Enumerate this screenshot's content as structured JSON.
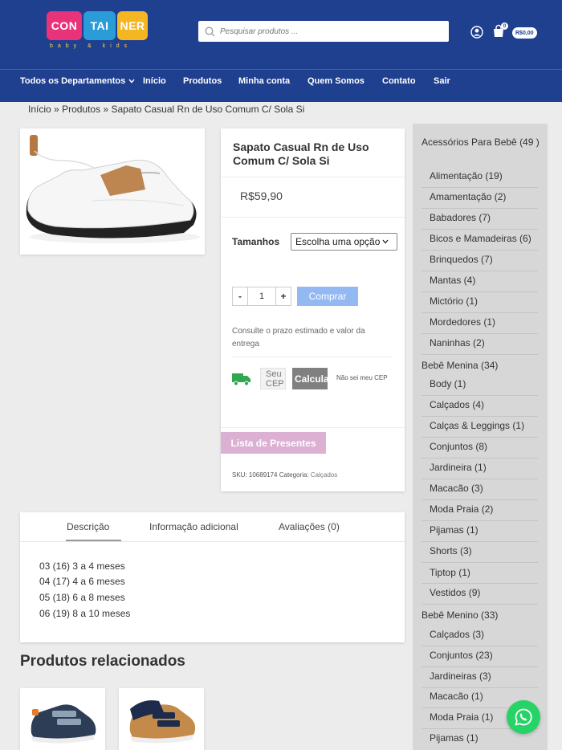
{
  "header": {
    "logo": {
      "parts": [
        "CON",
        "TAI",
        "NER"
      ],
      "tagline": "baby & kids"
    },
    "search_placeholder": "Pesquisar produtos ...",
    "cart_count": "0",
    "cart_total": "R$0,00",
    "icons": {
      "user": "user-icon",
      "cart": "cart-icon",
      "search": "search-icon"
    }
  },
  "nav": [
    {
      "label": "Todos os Departamentos"
    },
    {
      "label": "Início"
    },
    {
      "label": "Produtos"
    },
    {
      "label": "Minha conta"
    },
    {
      "label": "Quem Somos"
    },
    {
      "label": "Contato"
    },
    {
      "label": "Sair"
    }
  ],
  "breadcrumb": {
    "home": "Início",
    "sep": "»",
    "products": "Produtos",
    "current": "Sapato Casual Rn de Uso Comum C/ Sola Si"
  },
  "product": {
    "title": "Sapato Casual Rn de Uso Comum C/ Sola Si",
    "price": "R$59,90",
    "size_label": "Tamanhos",
    "size_select": "Escolha uma opção",
    "qty_minus": "-",
    "qty_value": "1",
    "qty_plus": "+",
    "buy_label": "Comprar",
    "shipping_note": "Consulte o prazo estimado e valor da entrega",
    "cep_placeholder": "Seu CEP",
    "cep_button": "Calcular",
    "cep_link": "Não sei meu CEP",
    "gift_button": "Lista de Presentes",
    "sku_label": "SKU:",
    "sku_value": "10689174",
    "category_label": "Categoria:",
    "category_value": "Calçados"
  },
  "tabs": {
    "items": [
      "Descrição",
      "Informação adicional",
      "Avaliações (0)"
    ],
    "description_lines": [
      "03 (16) 3 a 4 meses",
      "04 (17) 4 a 6 meses",
      "05 (18) 6 a 8 meses",
      "06 (19) 8 a 10 meses"
    ]
  },
  "related": {
    "title": "Produtos relacionados"
  },
  "sidebar": {
    "groups": [
      {
        "label": "Acessórios Para Bebê (49 )",
        "items": [
          "Alimentação (19)",
          "Amamentação (2)",
          "Babadores (7)",
          "Bicos e Mamadeiras (6)",
          "Brinquedos (7)",
          "Mantas (4)",
          "Mictório (1)",
          "Mordedores (1)",
          "Naninhas (2)"
        ]
      },
      {
        "label": "Bebê Menina (34)",
        "items": [
          "Body (1)",
          "Calçados (4)",
          "Calças & Leggings (1)",
          "Conjuntos (8)",
          "Jardineira (1)",
          "Macacão (3)",
          "Moda Praia (2)",
          "Pijamas (1)",
          "Shorts (3)",
          "Tiptop (1)",
          "Vestidos (9)"
        ]
      },
      {
        "label": "Bebê Menino (33)",
        "items": [
          "Calçados (3)",
          "Conjuntos (23)",
          "Jardineiras (3)",
          "Macacão (1)",
          "Moda Praia (1)",
          "Pijamas (1)"
        ]
      }
    ]
  },
  "colors": {
    "header_bg": "#1f3f8f",
    "buy_button": "#93b8f2",
    "gift_button": "#dbb0d3",
    "whatsapp": "#25d366"
  }
}
